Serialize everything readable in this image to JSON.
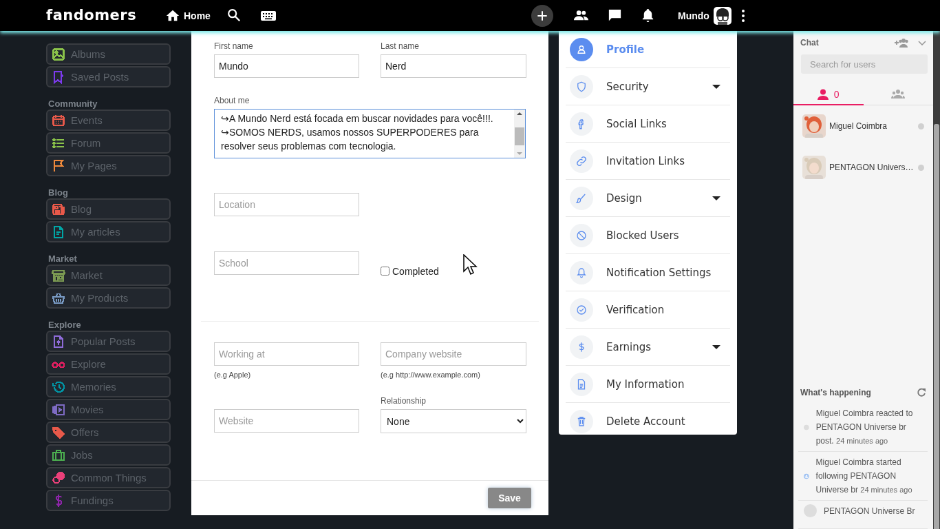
{
  "header": {
    "logo": "fandomers",
    "home": "Home",
    "user": "Mundo"
  },
  "sidebar": {
    "sections": [
      {
        "items": [
          {
            "label": "Albums",
            "color": "#8bc34a"
          },
          {
            "label": "Saved Posts",
            "color": "#7c3aed"
          }
        ]
      },
      {
        "title": "Community",
        "items": [
          {
            "label": "Events",
            "color": "#e8594a"
          },
          {
            "label": "Forum",
            "color": "#8bc34a"
          },
          {
            "label": "My Pages",
            "color": "#f08a3c"
          }
        ]
      },
      {
        "title": "Blog",
        "items": [
          {
            "label": "Blog",
            "color": "#e8594a"
          },
          {
            "label": "My articles",
            "color": "#00a6a6"
          }
        ]
      },
      {
        "title": "Market",
        "items": [
          {
            "label": "Market",
            "color": "#7b9a52"
          },
          {
            "label": "My Products",
            "color": "#7a9cc6"
          }
        ]
      },
      {
        "title": "Explore",
        "items": [
          {
            "label": "Popular Posts",
            "color": "#8e6bd8"
          },
          {
            "label": "Explore",
            "color": "#e91e63"
          },
          {
            "label": "Memories",
            "color": "#0097a7"
          },
          {
            "label": "Movies",
            "color": "#7e6bc4"
          },
          {
            "label": "Offers",
            "color": "#e8594a"
          },
          {
            "label": "Jobs",
            "color": "#4caf50"
          },
          {
            "label": "Common Things",
            "color": "#ec407a"
          },
          {
            "label": "Fundings",
            "color": "#8e24aa"
          }
        ]
      }
    ]
  },
  "form": {
    "first_name": {
      "label": "First name",
      "value": "Mundo"
    },
    "last_name": {
      "label": "Last name",
      "value": "Nerd"
    },
    "about_me": {
      "label": "About me",
      "value": "↪A Mundo Nerd está focada em buscar novidades para você!!!.\n↪SOMOS NERDS, usamos nossos SUPERPODERES para resolver seus problemas com tecnologia."
    },
    "location": {
      "placeholder": "Location"
    },
    "school": {
      "placeholder": "School"
    },
    "completed": {
      "label": "Completed",
      "checked": false
    },
    "working_at": {
      "placeholder": "Working at",
      "hint": "(e.g Apple)"
    },
    "company_website": {
      "placeholder": "Company website",
      "hint": "(e.g http://www.example.com)"
    },
    "website": {
      "placeholder": "Website"
    },
    "relationship": {
      "label": "Relationship",
      "value": "None"
    },
    "save": "Save"
  },
  "settings_menu": [
    {
      "label": "Profile",
      "selected": true,
      "expandable": false
    },
    {
      "label": "Security",
      "selected": false,
      "expandable": true
    },
    {
      "label": "Social Links",
      "selected": false,
      "expandable": false
    },
    {
      "label": "Invitation Links",
      "selected": false,
      "expandable": false
    },
    {
      "label": "Design",
      "selected": false,
      "expandable": true
    },
    {
      "label": "Blocked Users",
      "selected": false,
      "expandable": false
    },
    {
      "label": "Notification Settings",
      "selected": false,
      "expandable": false
    },
    {
      "label": "Verification",
      "selected": false,
      "expandable": false
    },
    {
      "label": "Earnings",
      "selected": false,
      "expandable": true
    },
    {
      "label": "My Information",
      "selected": false,
      "expandable": false
    },
    {
      "label": "Delete Account",
      "selected": false,
      "expandable": false
    }
  ],
  "chat": {
    "title": "Chat",
    "search": {
      "placeholder": "Search for users"
    },
    "tabs": [
      {
        "count": "0",
        "selected": true
      },
      {
        "selected": false
      }
    ],
    "contacts": [
      {
        "name": "Miguel Coimbra",
        "online": false
      },
      {
        "name": "PENTAGON Univers…",
        "online": false
      }
    ],
    "activity_title": "What's happening",
    "activities": [
      {
        "kind": "reaction",
        "text": "Miguel Coimbra reacted to PENTAGON Universe br post.",
        "time": "24 minutes ago"
      },
      {
        "kind": "follow",
        "text": "Miguel Coimbra started following PENTAGON Universe br",
        "time": "24 minutes ago"
      },
      {
        "kind": "reaction",
        "text": "PENTAGON Universe Br"
      }
    ]
  }
}
